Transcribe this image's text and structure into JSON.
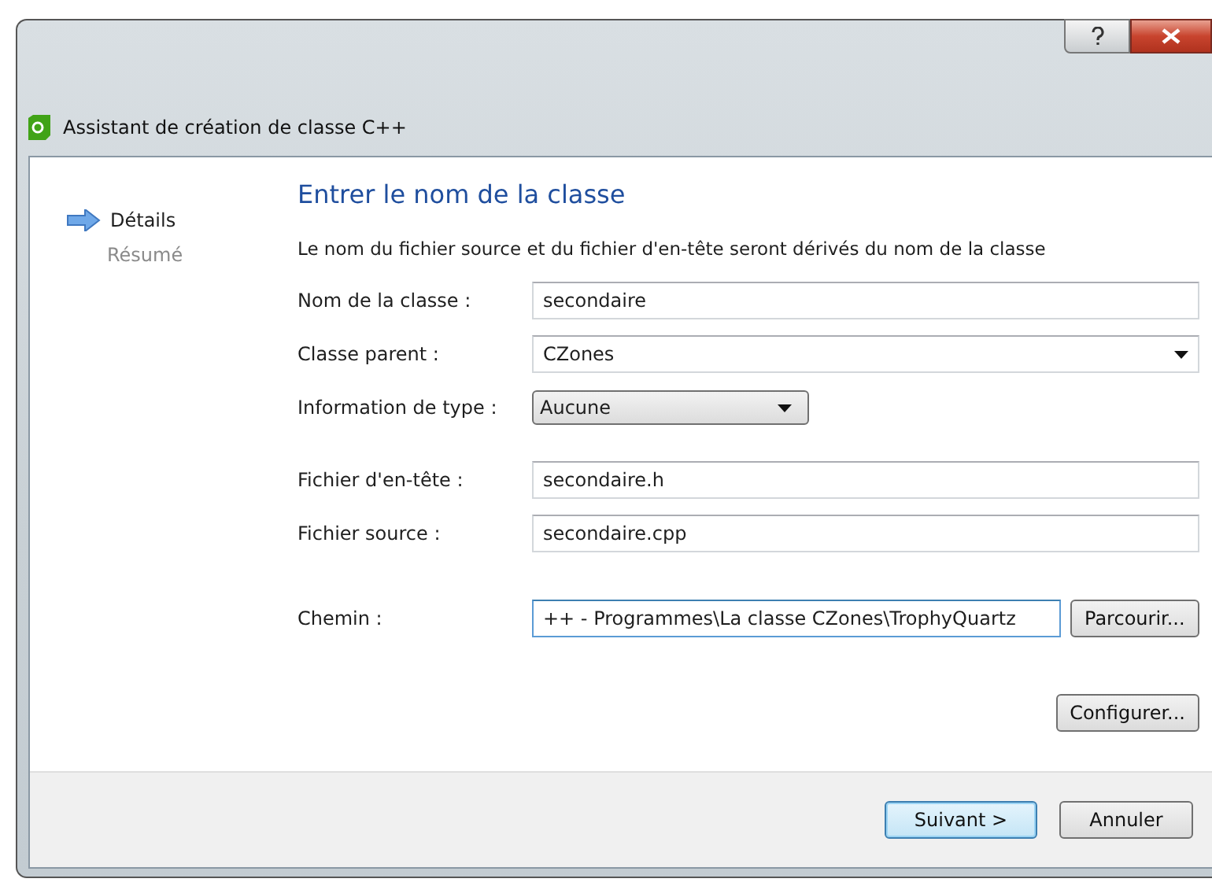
{
  "window": {
    "title": "Assistant de création de classe C++"
  },
  "steps": [
    {
      "label": "Détails",
      "selected": true
    },
    {
      "label": "Résumé",
      "selected": false
    }
  ],
  "heading": "Entrer le nom de la classe",
  "description": "Le nom du fichier source et du fichier d'en-tête seront dérivés du nom de la classe",
  "fields": [
    {
      "kind": "text",
      "label": "Nom de la classe :",
      "value": "secondaire"
    },
    {
      "kind": "combo",
      "label": "Classe parent :",
      "value": "CZones"
    },
    {
      "kind": "dropdown",
      "label": "Information de type :",
      "value": "Aucune"
    },
    {
      "kind": "gap"
    },
    {
      "kind": "text",
      "label": "Fichier d'en-tête :",
      "value": "secondaire.h"
    },
    {
      "kind": "text",
      "label": "Fichier source :",
      "value": "secondaire.cpp"
    },
    {
      "kind": "gap"
    },
    {
      "kind": "path",
      "label": "Chemin :",
      "value": "++ - Programmes\\La classe CZones\\TrophyQuartz",
      "focused": true,
      "button": "Parcourir..."
    }
  ],
  "configure_button": "Configurer...",
  "footer_buttons": [
    {
      "label": "Suivant >",
      "default": true
    },
    {
      "label": "Annuler",
      "default": false
    }
  ]
}
